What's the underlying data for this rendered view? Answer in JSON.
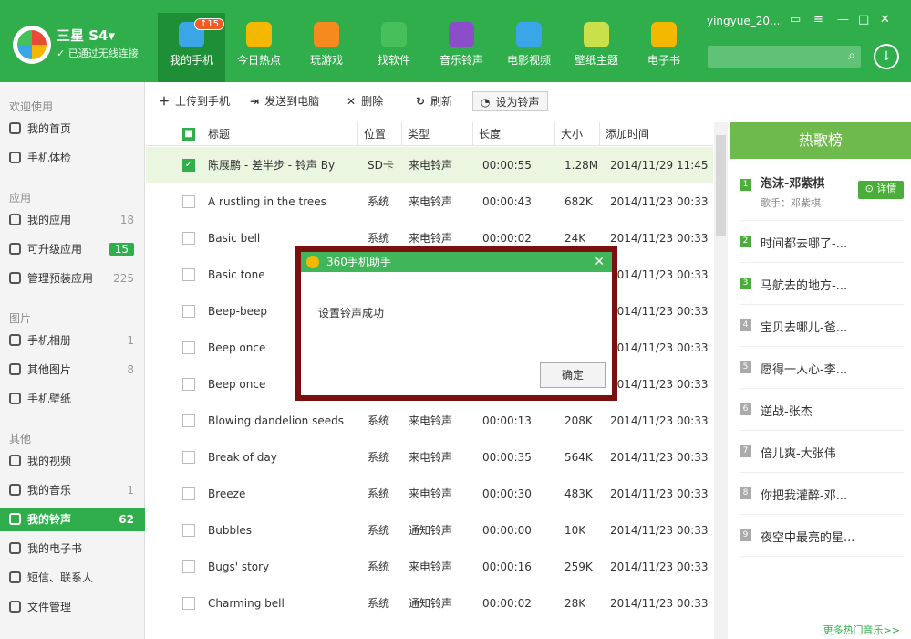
{
  "header": {
    "device_name": "三星 S4▾",
    "connection": "✓ 已通过无线连接",
    "username": "yingyue_20...",
    "nav": [
      {
        "label": "我的手机",
        "badge": "↑15",
        "color": "#3aa6e8"
      },
      {
        "label": "今日热点",
        "color": "#f5b800"
      },
      {
        "label": "玩游戏",
        "color": "#f58a1f"
      },
      {
        "label": "找软件",
        "color": "#46c05a"
      },
      {
        "label": "音乐铃声",
        "color": "#8a4fc8"
      },
      {
        "label": "电影视频",
        "color": "#3aa6e8"
      },
      {
        "label": "壁纸主题",
        "color": "#c9e04a"
      },
      {
        "label": "电子书",
        "color": "#f5b800"
      }
    ]
  },
  "sidebar": {
    "sections": [
      {
        "title": "欢迎使用",
        "items": [
          {
            "label": "我的首页",
            "icon": "home-icon"
          },
          {
            "label": "手机体检",
            "icon": "checkup-icon"
          }
        ]
      },
      {
        "title": "应用",
        "items": [
          {
            "label": "我的应用",
            "count": "18",
            "icon": "apps-icon"
          },
          {
            "label": "可升级应用",
            "count": "15",
            "icon": "upgrade-icon"
          },
          {
            "label": "管理预装应用",
            "count": "225",
            "icon": "preinstall-icon"
          }
        ]
      },
      {
        "title": "图片",
        "items": [
          {
            "label": "手机相册",
            "count": "1",
            "icon": "camera-icon"
          },
          {
            "label": "其他图片",
            "count": "8",
            "icon": "image-icon"
          },
          {
            "label": "手机壁纸",
            "icon": "wallpaper-icon"
          }
        ]
      },
      {
        "title": "其他",
        "items": [
          {
            "label": "我的视频",
            "icon": "video-icon"
          },
          {
            "label": "我的音乐",
            "count": "1",
            "icon": "music-icon"
          },
          {
            "label": "我的铃声",
            "count": "62",
            "icon": "bell-icon"
          },
          {
            "label": "我的电子书",
            "icon": "book-icon"
          },
          {
            "label": "短信、联系人",
            "icon": "mail-icon"
          },
          {
            "label": "文件管理",
            "icon": "folder-icon"
          }
        ]
      }
    ]
  },
  "toolbar": {
    "upload": "上传到手机",
    "send": "发送到电脑",
    "delete": "删除",
    "refresh": "刷新",
    "set_ringtone": "设为铃声"
  },
  "table": {
    "headers": [
      "标题",
      "位置",
      "类型",
      "长度",
      "大小",
      "添加时间"
    ],
    "rows": [
      [
        "陈展鹏 - 差半步 - 铃声 By",
        "SD卡",
        "来电铃声",
        "00:00:55",
        "1.28M",
        "2014/11/29 11:45"
      ],
      [
        "A rustling in the trees",
        "系统",
        "来电铃声",
        "00:00:43",
        "682K",
        "2014/11/23 00:33"
      ],
      [
        "Basic bell",
        "系统",
        "来电铃声",
        "00:00:02",
        "24K",
        "2014/11/23 00:33"
      ],
      [
        "Basic tone",
        "",
        "",
        "",
        "",
        "2014/11/23 00:33"
      ],
      [
        "Beep-beep",
        "",
        "",
        "",
        "",
        "2014/11/23 00:33"
      ],
      [
        "Beep once",
        "",
        "",
        "",
        "",
        "2014/11/23 00:33"
      ],
      [
        "Beep once",
        "",
        "",
        "",
        "",
        "2014/11/23 00:33"
      ],
      [
        "Blowing dandelion seeds",
        "系统",
        "来电铃声",
        "00:00:13",
        "208K",
        "2014/11/23 00:33"
      ],
      [
        "Break of day",
        "系统",
        "来电铃声",
        "00:00:35",
        "564K",
        "2014/11/23 00:33"
      ],
      [
        "Breeze",
        "系统",
        "来电铃声",
        "00:00:30",
        "483K",
        "2014/11/23 00:33"
      ],
      [
        "Bubbles",
        "系统",
        "通知铃声",
        "00:00:00",
        "10K",
        "2014/11/23 00:33"
      ],
      [
        "Bugs' story",
        "系统",
        "来电铃声",
        "00:00:16",
        "259K",
        "2014/11/23 00:33"
      ],
      [
        "Charming bell",
        "系统",
        "通知铃声",
        "00:00:02",
        "28K",
        "2014/11/23 00:33"
      ]
    ]
  },
  "hot_list": {
    "title": "热歌榜",
    "first": {
      "num": "1",
      "title": "泡沫-邓紫棋",
      "singer": "歌手：邓紫棋",
      "detail": "详情"
    },
    "items": [
      {
        "num": "2",
        "title": "时间都去哪了-..."
      },
      {
        "num": "3",
        "title": "马航去的地方-..."
      },
      {
        "num": "4",
        "title": "宝贝去哪儿-爸..."
      },
      {
        "num": "5",
        "title": "愿得一人心-李..."
      },
      {
        "num": "6",
        "title": "逆战-张杰"
      },
      {
        "num": "7",
        "title": "倍儿爽-大张伟"
      },
      {
        "num": "8",
        "title": "你把我灌醉-邓..."
      },
      {
        "num": "9",
        "title": "夜空中最亮的星..."
      }
    ],
    "more": "更多热门音乐>>"
  },
  "modal": {
    "title": "360手机助手",
    "message": "设置铃声成功",
    "ok": "确定"
  }
}
